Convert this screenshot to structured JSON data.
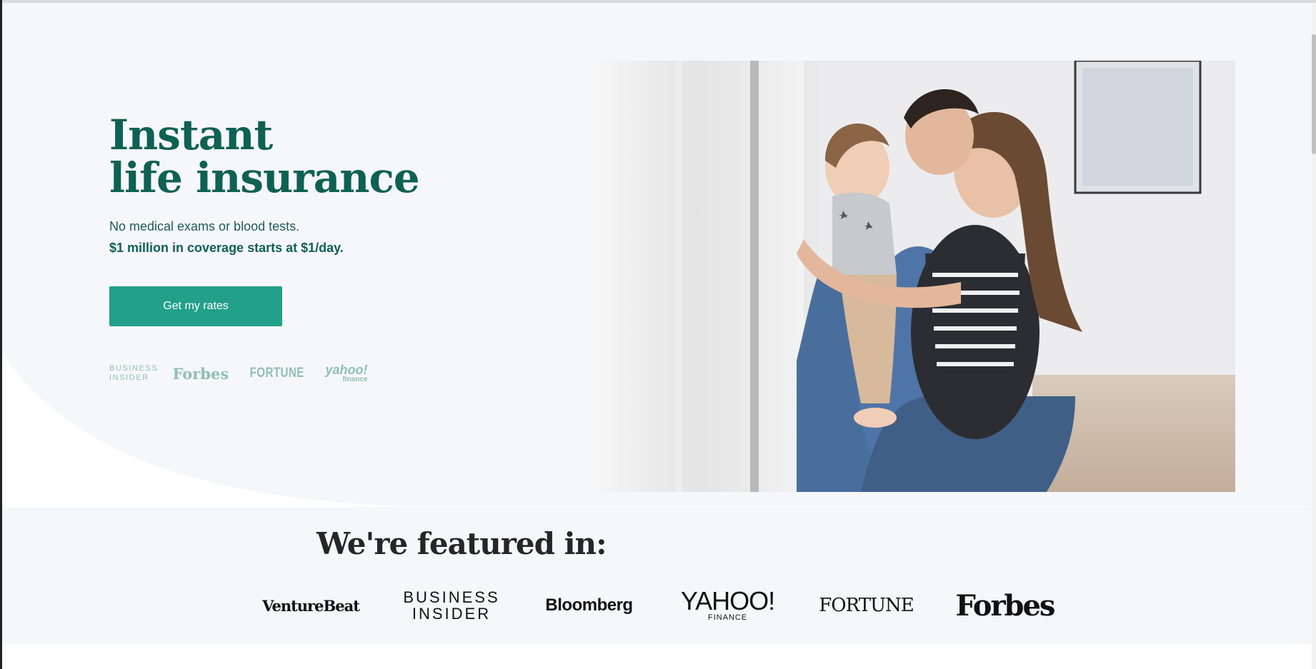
{
  "hero": {
    "title_line1": "Instant",
    "title_line2": "life insurance",
    "subtitle": "No medical exams or blood tests.",
    "subtitle_bold": "$1 million in coverage starts at $1/day.",
    "cta_label": "Get my rates",
    "mini_logos": {
      "business_insider_line1": "BUSINESS",
      "business_insider_line2": "INSIDER",
      "forbes": "Forbes",
      "fortune": "FORTUNE",
      "yahoo_line1": "yahoo!",
      "yahoo_line2": "finance"
    },
    "photo_icon": "family-photo"
  },
  "featured": {
    "title": "We're featured in:",
    "logos": {
      "venturebeat": "VentureBeat",
      "business_insider_line1": "BUSINESS",
      "business_insider_line2": "INSIDER",
      "bloomberg": "Bloomberg",
      "yahoo_line1": "YAHOO!",
      "yahoo_line2": "FINANCE",
      "fortune": "FORTUNE",
      "forbes": "Forbes"
    }
  },
  "colors": {
    "brand_green": "#0e6153",
    "button_green": "#22a089",
    "hero_background": "#f6f7fb",
    "muted_logo": "#8fbfb3"
  }
}
